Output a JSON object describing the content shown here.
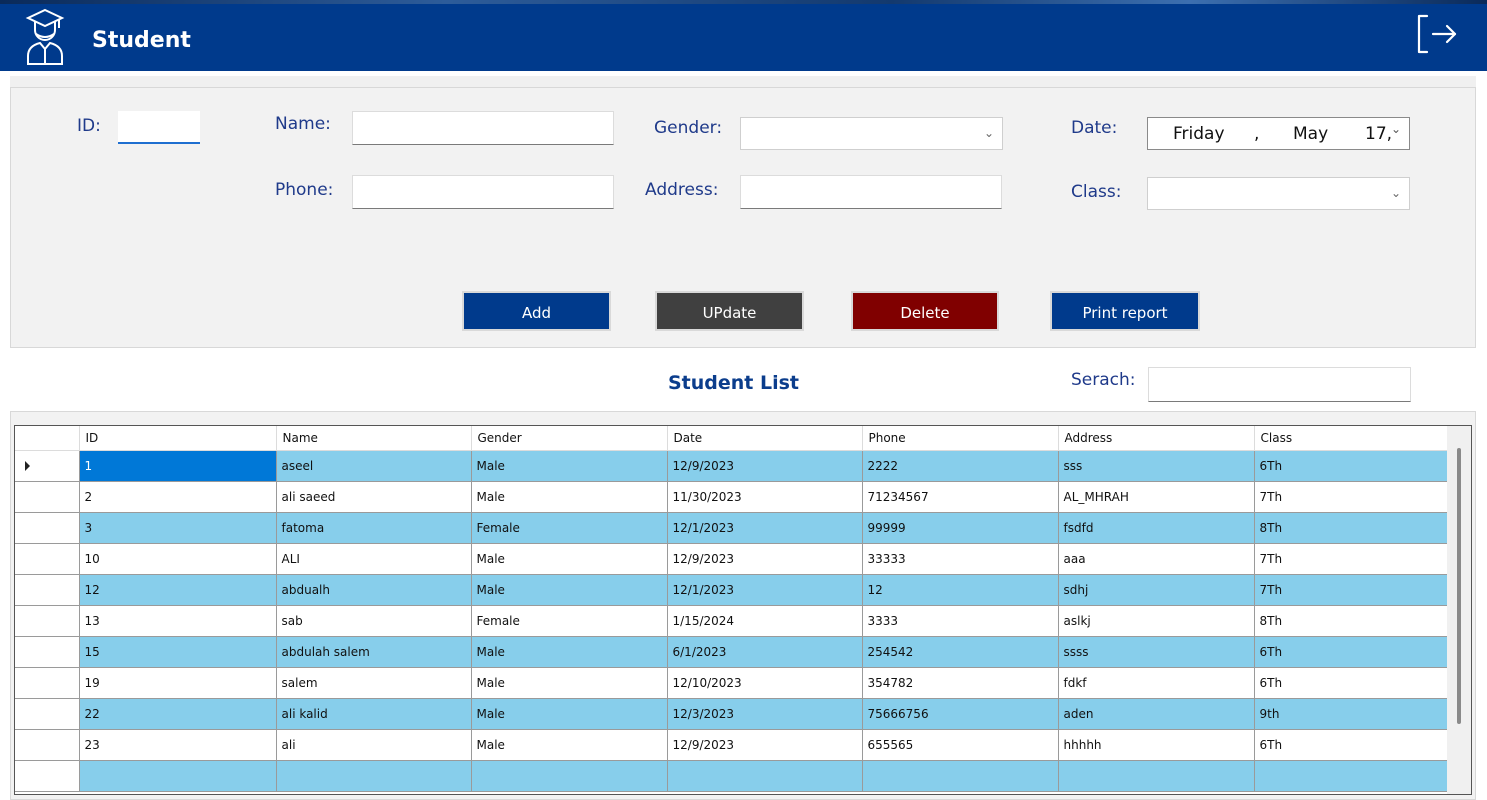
{
  "header": {
    "title": "Student",
    "app_icon": "student-graduate-icon",
    "exit_icon": "logout-icon",
    "bg_color": "#003a8c"
  },
  "form": {
    "id_label": "ID:",
    "name_label": "Name:",
    "gender_label": "Gender:",
    "date_label": "Date:",
    "phone_label": "Phone:",
    "address_label": "Address:",
    "class_label": "Class:",
    "id_value": "",
    "name_value": "",
    "phone_value": "",
    "address_value": "",
    "gender_value": "",
    "class_value": "",
    "date_day": "Friday",
    "date_sep": ",",
    "date_month": "May",
    "date_daynum": "17,"
  },
  "buttons": {
    "add": "Add",
    "update": "UPdate",
    "delete": "Delete",
    "print": "Print report",
    "add_color": "#003a8c",
    "update_color": "#404040",
    "delete_color": "#800000",
    "print_color": "#003a8c"
  },
  "list": {
    "title": "Student List",
    "search_label": "Serach:",
    "search_value": "",
    "columns": [
      "ID",
      "Name",
      "Gender",
      "Date",
      "Phone",
      "Address",
      "Class"
    ],
    "rows": [
      [
        "1",
        "aseel",
        "Male",
        "12/9/2023",
        "2222",
        "sss",
        "6Th"
      ],
      [
        "2",
        "ali saeed",
        "Male",
        "11/30/2023",
        "71234567",
        "AL_MHRAH",
        "7Th"
      ],
      [
        "3",
        "fatoma",
        "Female",
        "12/1/2023",
        "99999",
        "fsdfd",
        "8Th"
      ],
      [
        "10",
        "ALI",
        "Male",
        "12/9/2023",
        "33333",
        "aaa",
        "7Th"
      ],
      [
        "12",
        "abdualh",
        "Male",
        "12/1/2023",
        "12",
        "sdhj",
        "7Th"
      ],
      [
        "13",
        "sab",
        "Female",
        "1/15/2024",
        "3333",
        "aslkj",
        "8Th"
      ],
      [
        "15",
        "abdulah salem",
        "Male",
        "6/1/2023",
        "254542",
        "ssss",
        "6Th"
      ],
      [
        "19",
        "salem",
        "Male",
        "12/10/2023",
        "354782",
        "fdkf",
        "6Th"
      ],
      [
        "22",
        "ali kalid",
        "Male",
        "12/3/2023",
        "75666756",
        "aden",
        "9th"
      ],
      [
        "23",
        "ali",
        "Male",
        "12/9/2023",
        "655565",
        "hhhhh",
        "6Th"
      ]
    ],
    "row_alt_color": "#87ceeb",
    "selected_color": "#0078d7"
  }
}
